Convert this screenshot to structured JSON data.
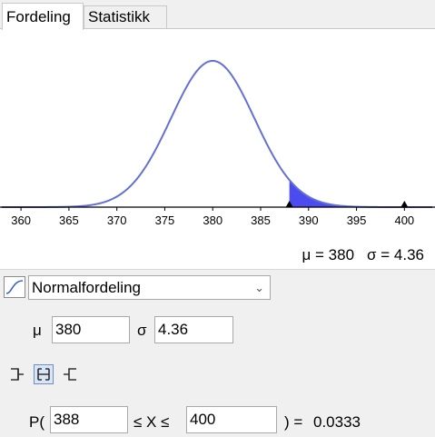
{
  "tabs": [
    {
      "label": "Fordeling",
      "active": true
    },
    {
      "label": "Statistikk",
      "active": false
    }
  ],
  "chart_data": {
    "type": "area",
    "distribution": "normal",
    "mean": 380,
    "sd": 4.36,
    "xlim": [
      358,
      403
    ],
    "x_ticks": [
      360,
      365,
      370,
      375,
      380,
      385,
      390,
      395,
      400
    ],
    "shaded_interval": [
      388,
      400
    ],
    "markers": [
      388,
      400
    ],
    "curve_color": "#6570d4",
    "fill_color": "#4b4bf0"
  },
  "summary": {
    "mu_text": "μ = 380",
    "sigma_text": "σ = 4.36"
  },
  "distribution_select": {
    "value": "Normalfordeling",
    "icon": "normal-distribution-icon"
  },
  "params": {
    "mu_label": "μ",
    "mu_value": "380",
    "sigma_label": "σ",
    "sigma_value": "4.36"
  },
  "interval_buttons": [
    {
      "name": "left-sided-icon",
      "selected": false
    },
    {
      "name": "interval-icon",
      "selected": true
    },
    {
      "name": "right-sided-icon",
      "selected": false
    }
  ],
  "probability": {
    "p_open": "P(",
    "lower": "388",
    "le1": "≤ X ≤",
    "upper": "400",
    "close_eq": ") =",
    "result": "0.0333"
  }
}
